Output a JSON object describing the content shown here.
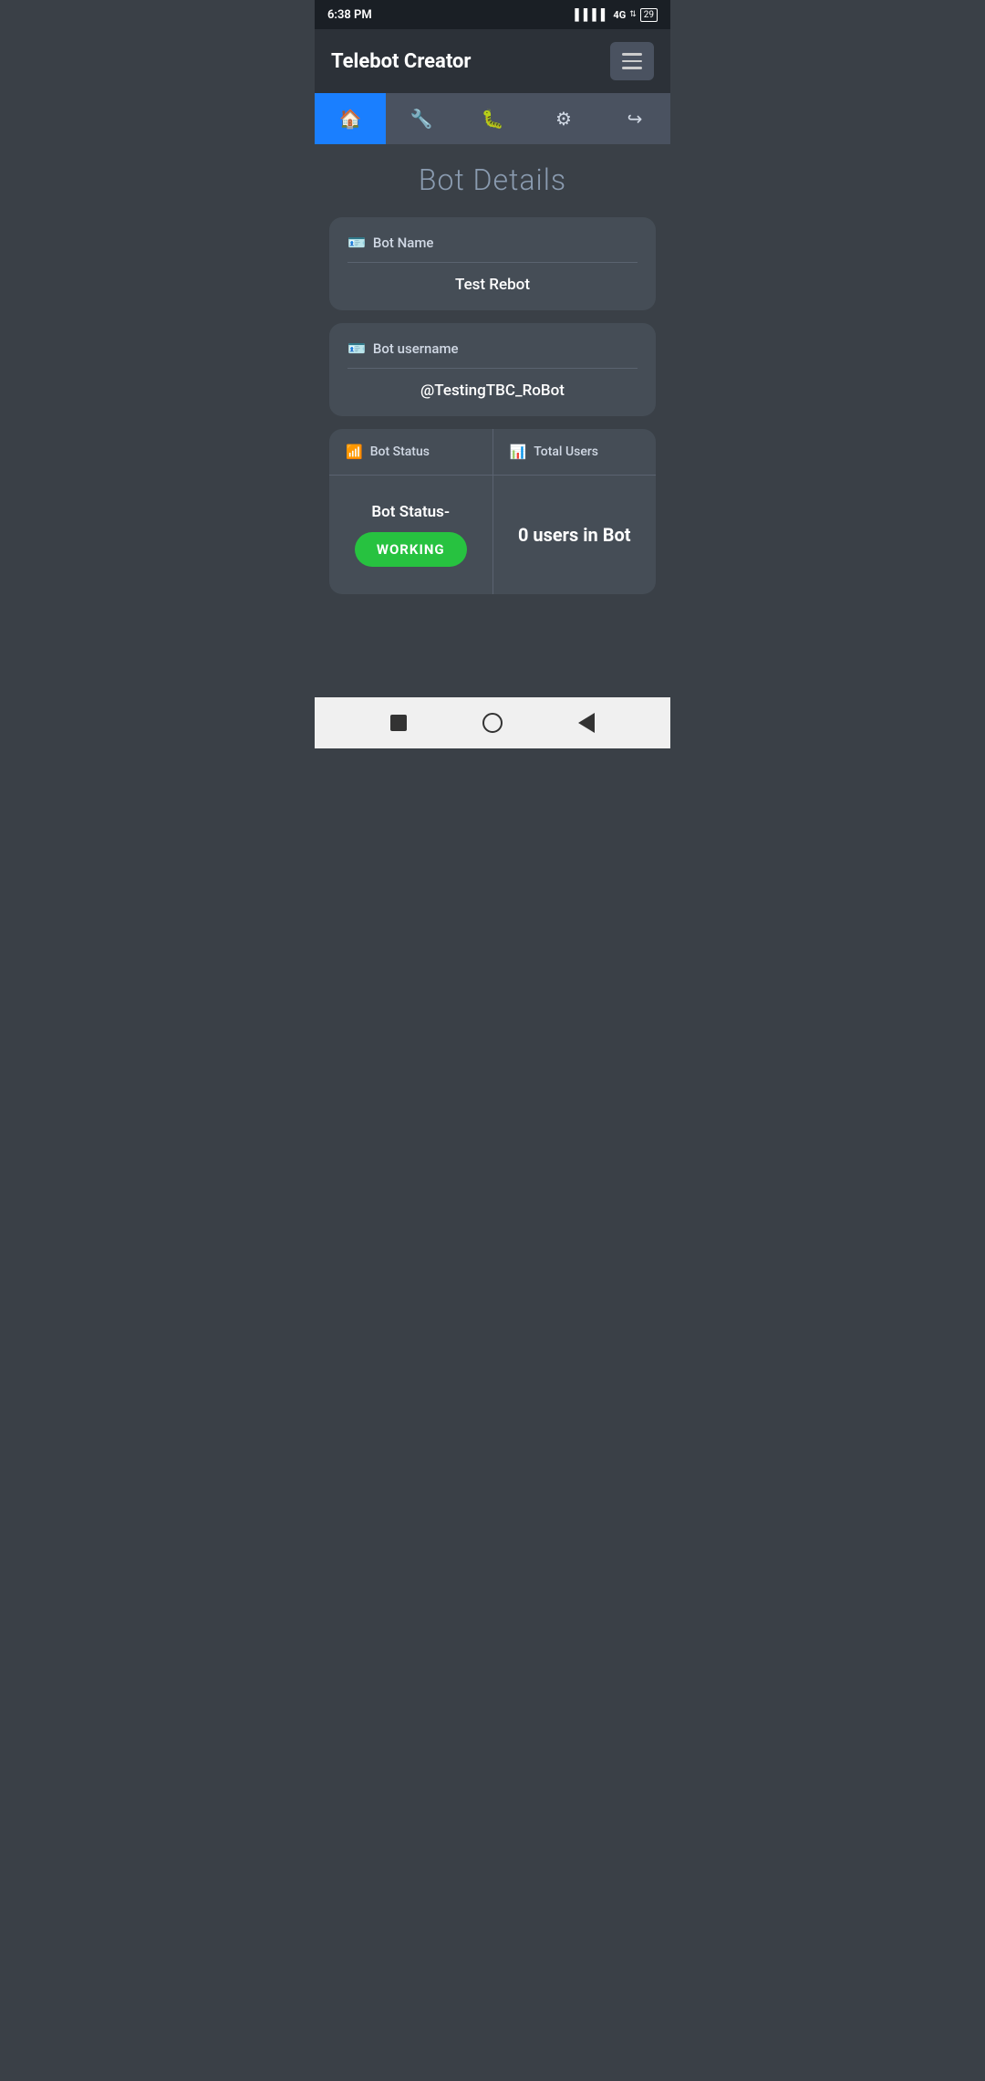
{
  "statusBar": {
    "time": "6:38 PM",
    "signal": "▌▌▌▌",
    "network": "4G",
    "battery": "29"
  },
  "header": {
    "title": "Telebot Creator",
    "menuLabel": "menu"
  },
  "navTabs": [
    {
      "id": "home",
      "icon": "🏠",
      "active": true
    },
    {
      "id": "tools",
      "icon": "🔧",
      "active": false
    },
    {
      "id": "debug",
      "icon": "🐛",
      "active": false
    },
    {
      "id": "settings",
      "icon": "⚙",
      "active": false
    },
    {
      "id": "export",
      "icon": "↪",
      "active": false
    }
  ],
  "pageTitle": "Bot Details",
  "botNameCard": {
    "label": "Bot Name",
    "iconSymbol": "🪪",
    "value": "Test Rebot"
  },
  "botUsernameCard": {
    "label": "Bot username",
    "iconSymbol": "🪪",
    "value": "@TestingTBC_RoBot"
  },
  "botStatusCard": {
    "leftHeader": "Bot Status",
    "leftHeaderIcon": "📶",
    "rightHeader": "Total Users",
    "rightHeaderIcon": "📊",
    "statusLabel": "Bot Status-",
    "statusBadge": "WORKING",
    "usersText": "0 users in Bot"
  },
  "bottomNav": {
    "stopLabel": "stop",
    "homeLabel": "home",
    "backLabel": "back"
  }
}
